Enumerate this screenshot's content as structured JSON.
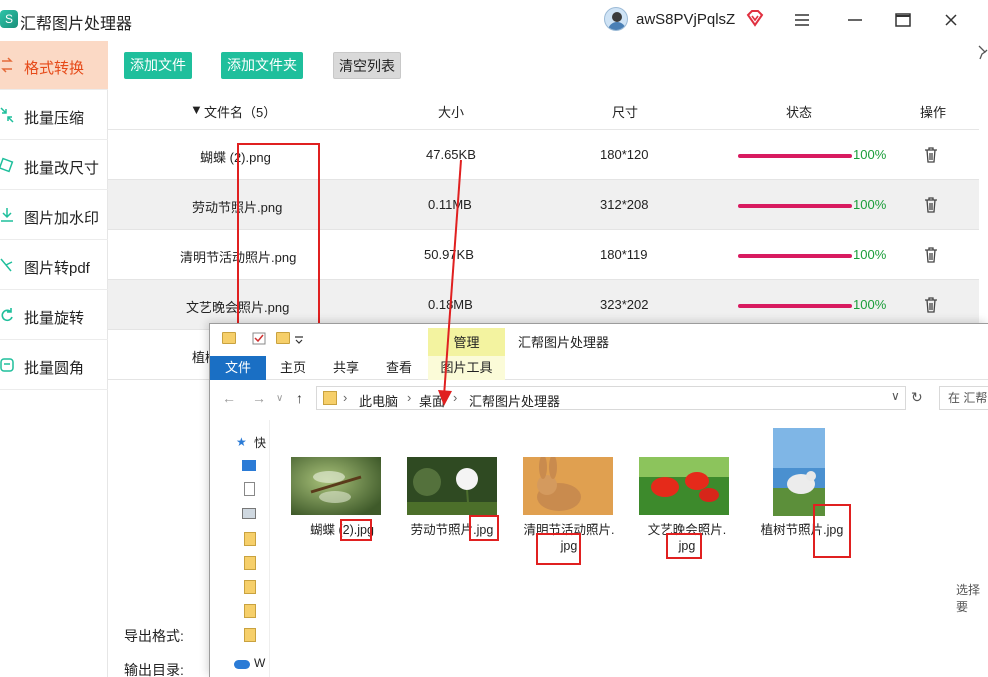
{
  "app": {
    "title": "汇帮图片处理器",
    "logo_glyph": "S",
    "username": "awS8PVjPqlsZ",
    "accent": "#1fbf9c",
    "active_bg": "#fbd9c5"
  },
  "sidebar": {
    "items": [
      {
        "label": "格式转换",
        "icon": "convert-icon",
        "active": true
      },
      {
        "label": "批量压缩",
        "icon": "compress-icon",
        "active": false
      },
      {
        "label": "批量改尺寸",
        "icon": "resize-icon",
        "active": false
      },
      {
        "label": "图片加水印",
        "icon": "watermark-icon",
        "active": false
      },
      {
        "label": "图片转pdf",
        "icon": "pdf-icon",
        "active": false
      },
      {
        "label": "批量旋转",
        "icon": "rotate-icon",
        "active": false
      },
      {
        "label": "批量圆角",
        "icon": "round-corner-icon",
        "active": false
      }
    ]
  },
  "toolbar": {
    "add_file": "添加文件",
    "add_folder": "添加文件夹",
    "clear_list": "清空列表"
  },
  "table": {
    "headers": {
      "name": "文件名（5）",
      "size": "大小",
      "dimensions": "尺寸",
      "status": "状态",
      "action": "操作"
    },
    "rows": [
      {
        "name": "蝴蝶 (2).png",
        "size": "47.65KB",
        "dimensions": "180*120",
        "progress": "100%"
      },
      {
        "name": "劳动节照片.png",
        "size": "0.11MB",
        "dimensions": "312*208",
        "progress": "100%"
      },
      {
        "name": "清明节活动照片.png",
        "size": "50.97KB",
        "dimensions": "180*119",
        "progress": "100%"
      },
      {
        "name": "文艺晚会照片.png",
        "size": "0.18MB",
        "dimensions": "323*202",
        "progress": "100%"
      },
      {
        "name": "植树",
        "size": "",
        "dimensions": "",
        "progress": ""
      }
    ]
  },
  "bottom": {
    "export_format_label": "导出格式:",
    "export_dir_label": "输出目录:"
  },
  "explorer": {
    "manage_tab": "管理",
    "title": "汇帮图片处理器",
    "tabs": {
      "file": "文件",
      "home": "主页",
      "share": "共享",
      "view": "查看",
      "picture_tools": "图片工具"
    },
    "breadcrumb": [
      "此电脑",
      "桌面",
      "汇帮图片处理器"
    ],
    "search_placeholder": "在 汇帮",
    "nav": {
      "quick_access": "快",
      "onedrive": "W"
    },
    "files": [
      {
        "name_line1": "蝴蝶 (2).jpg",
        "name_line2": ""
      },
      {
        "name_line1": "劳动节照片.jpg",
        "name_line2": ""
      },
      {
        "name_line1": "清明节活动照片.",
        "name_line2": "jpg"
      },
      {
        "name_line1": "文艺晚会照片.",
        "name_line2": "jpg"
      },
      {
        "name_line1": "植树节照片.jpg",
        "name_line2": ""
      }
    ],
    "status_hint": "选择要"
  }
}
